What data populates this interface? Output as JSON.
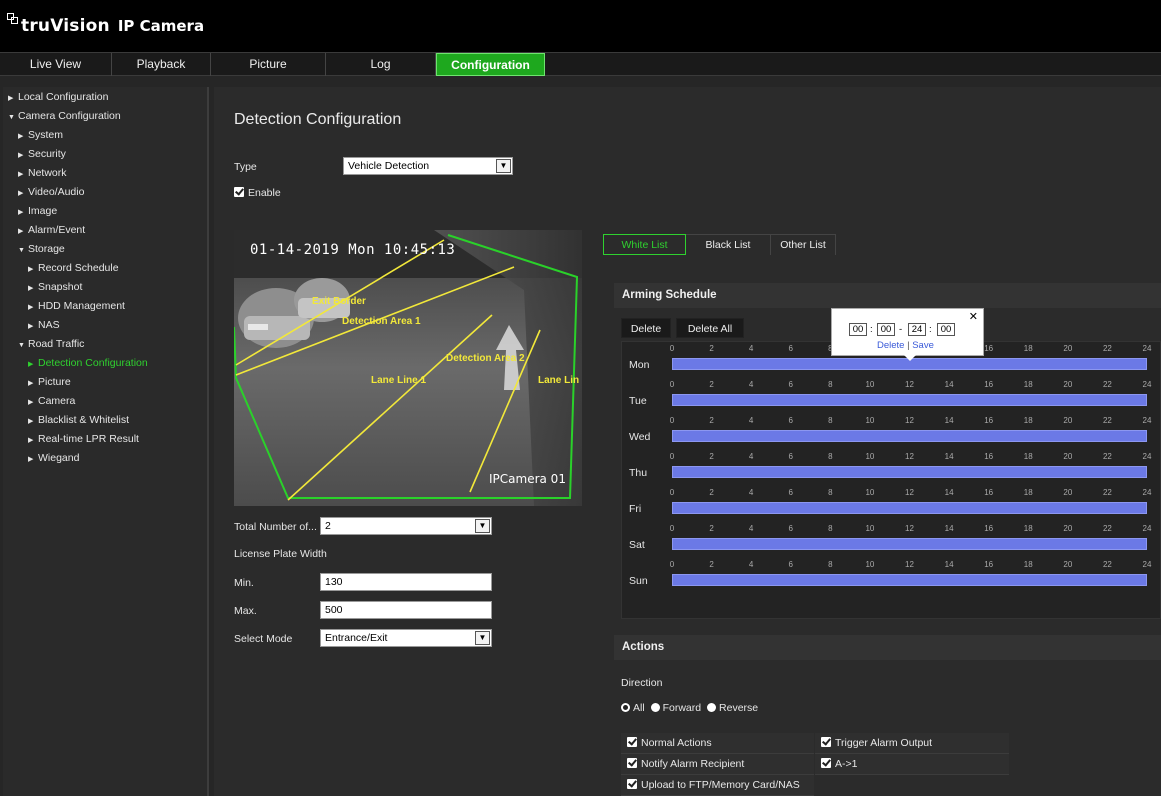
{
  "header": {
    "brand": "truVision",
    "product": "IP Camera"
  },
  "nav": {
    "tabs": [
      "Live View",
      "Playback",
      "Picture",
      "Log",
      "Configuration"
    ],
    "active": "Configuration"
  },
  "sidebar": {
    "items": [
      {
        "label": "Local Configuration",
        "level": 0,
        "expanded": false
      },
      {
        "label": "Camera Configuration",
        "level": 0,
        "expanded": true
      },
      {
        "label": "System",
        "level": 1,
        "expanded": false
      },
      {
        "label": "Security",
        "level": 1,
        "expanded": false
      },
      {
        "label": "Network",
        "level": 1,
        "expanded": false
      },
      {
        "label": "Video/Audio",
        "level": 1,
        "expanded": false
      },
      {
        "label": "Image",
        "level": 1,
        "expanded": false
      },
      {
        "label": "Alarm/Event",
        "level": 1,
        "expanded": false
      },
      {
        "label": "Storage",
        "level": 1,
        "expanded": true
      },
      {
        "label": "Record Schedule",
        "level": 2,
        "expanded": false
      },
      {
        "label": "Snapshot",
        "level": 2,
        "expanded": false
      },
      {
        "label": "HDD Management",
        "level": 2,
        "expanded": false
      },
      {
        "label": "NAS",
        "level": 2,
        "expanded": false
      },
      {
        "label": "Road Traffic",
        "level": 1,
        "expanded": true
      },
      {
        "label": "Detection Configuration",
        "level": 2,
        "expanded": false,
        "active": true
      },
      {
        "label": "Picture",
        "level": 2,
        "expanded": false
      },
      {
        "label": "Camera",
        "level": 2,
        "expanded": false
      },
      {
        "label": "Blacklist & Whitelist",
        "level": 2,
        "expanded": false
      },
      {
        "label": "Real-time LPR Result",
        "level": 2,
        "expanded": false
      },
      {
        "label": "Wiegand",
        "level": 2,
        "expanded": false
      }
    ]
  },
  "main": {
    "title": "Detection Configuration",
    "type_label": "Type",
    "type_value": "Vehicle Detection",
    "enable_label": "Enable",
    "video": {
      "osd_datetime": "01-14-2019 Mon 10:45:13",
      "osd_camera": "IPCamera 01",
      "overlay_labels": [
        "Exit Border",
        "Detection Area 1",
        "Detection Area 2",
        "Lane Line 1",
        "Lane Lin"
      ]
    },
    "total_lanes_label": "Total Number of...",
    "total_lanes_value": "2",
    "plate_width_label": "License Plate Width",
    "min_label": "Min.",
    "min_value": "130",
    "max_label": "Max.",
    "max_value": "500",
    "select_mode_label": "Select Mode",
    "select_mode_value": "Entrance/Exit"
  },
  "lists": {
    "tabs": [
      "White List",
      "Black List",
      "Other List"
    ],
    "active": "White List"
  },
  "schedule": {
    "title": "Arming Schedule",
    "delete_label": "Delete",
    "delete_all_label": "Delete All",
    "days": [
      "Mon",
      "Tue",
      "Wed",
      "Thu",
      "Fri",
      "Sat",
      "Sun"
    ],
    "hours": [
      "0",
      "2",
      "4",
      "6",
      "8",
      "10",
      "12",
      "14",
      "16",
      "18",
      "20",
      "22",
      "24"
    ],
    "popup": {
      "start_h": "00",
      "start_m": "00",
      "end_h": "24",
      "end_m": "00",
      "sep_colon": ":",
      "sep_dash": "-",
      "delete_link": "Delete",
      "save_link": "Save",
      "bar": "|"
    }
  },
  "actions": {
    "title": "Actions",
    "direction_label": "Direction",
    "direction_options": [
      "All",
      "Forward",
      "Reverse"
    ],
    "direction_selected": "All",
    "normal_actions": "Normal Actions",
    "notify_recipient": "Notify Alarm Recipient",
    "upload": "Upload to FTP/Memory Card/NAS",
    "trigger_alarm_output": "Trigger Alarm Output",
    "alarm_output_item": "A->1"
  },
  "colors": {
    "accent_green": "#1ea81e",
    "schedule_bar": "#6b79e6",
    "active_link": "#2fd12f"
  }
}
